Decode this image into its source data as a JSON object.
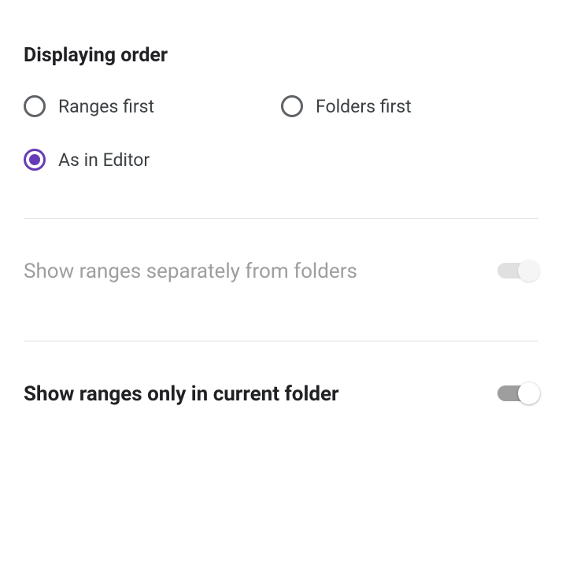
{
  "displayOrder": {
    "title": "Displaying order",
    "options": {
      "rangesFirst": "Ranges first",
      "foldersFirst": "Folders first",
      "asInEditor": "As in Editor"
    },
    "selected": "asInEditor"
  },
  "toggles": {
    "separateRanges": {
      "label": "Show ranges separately from folders",
      "value": false,
      "disabled": true
    },
    "currentFolderOnly": {
      "label": "Show ranges only in current folder",
      "value": true,
      "disabled": false
    }
  }
}
